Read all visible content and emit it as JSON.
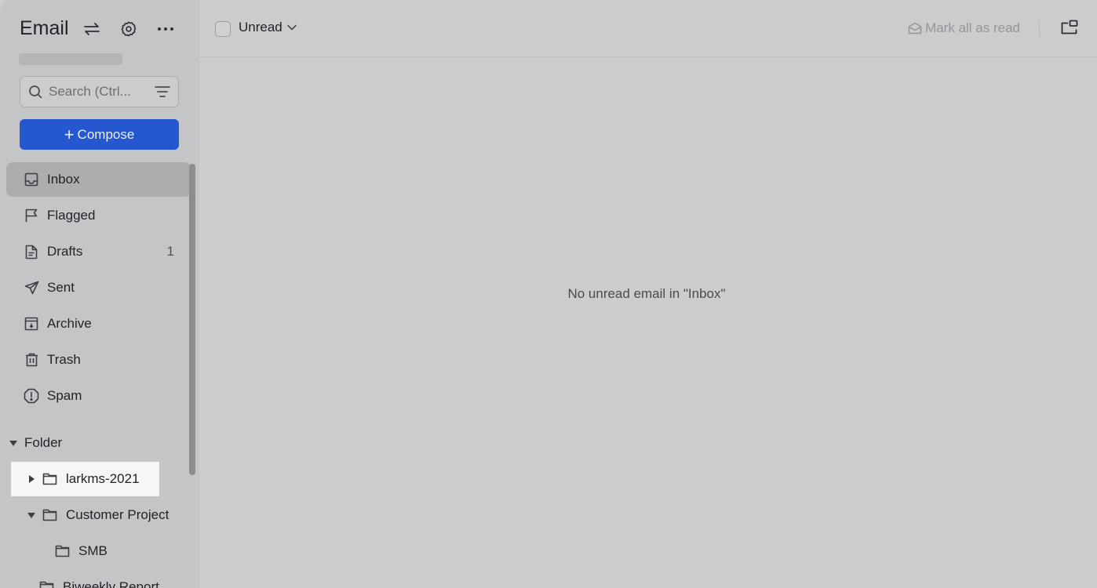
{
  "app": {
    "title": "Email",
    "header_icons": [
      "switch-account-icon",
      "settings-gear-icon",
      "more-options-icon"
    ]
  },
  "search": {
    "placeholder": "Search (Ctrl..."
  },
  "compose": {
    "label": "Compose"
  },
  "nav": {
    "items": [
      {
        "label": "Inbox",
        "icon": "inbox-icon",
        "active": true,
        "count": ""
      },
      {
        "label": "Flagged",
        "icon": "flag-icon",
        "active": false,
        "count": ""
      },
      {
        "label": "Drafts",
        "icon": "draft-document-icon",
        "active": false,
        "count": "1"
      },
      {
        "label": "Sent",
        "icon": "paper-plane-icon",
        "active": false,
        "count": ""
      },
      {
        "label": "Archive",
        "icon": "archive-box-icon",
        "active": false,
        "count": ""
      },
      {
        "label": "Trash",
        "icon": "trash-icon",
        "active": false,
        "count": ""
      },
      {
        "label": "Spam",
        "icon": "spam-alert-icon",
        "active": false,
        "count": ""
      }
    ]
  },
  "folders": {
    "header": "Folder",
    "items": [
      {
        "label": "larkms-2021",
        "expanded": false,
        "highlighted": true
      },
      {
        "label": "Customer Project",
        "expanded": true,
        "highlighted": false
      },
      {
        "label": "SMB",
        "expanded": null,
        "highlighted": false
      },
      {
        "label": "Biweekly Report",
        "expanded": null,
        "highlighted": false
      }
    ]
  },
  "toolbar": {
    "filter_label": "Unread",
    "mark_all_label": "Mark all as read"
  },
  "main": {
    "empty_message": "No unread email in \"Inbox\""
  },
  "colors": {
    "accent": "#2557d0",
    "sidebar_bg": "#c4c5c7",
    "main_bg": "#cccccc"
  }
}
